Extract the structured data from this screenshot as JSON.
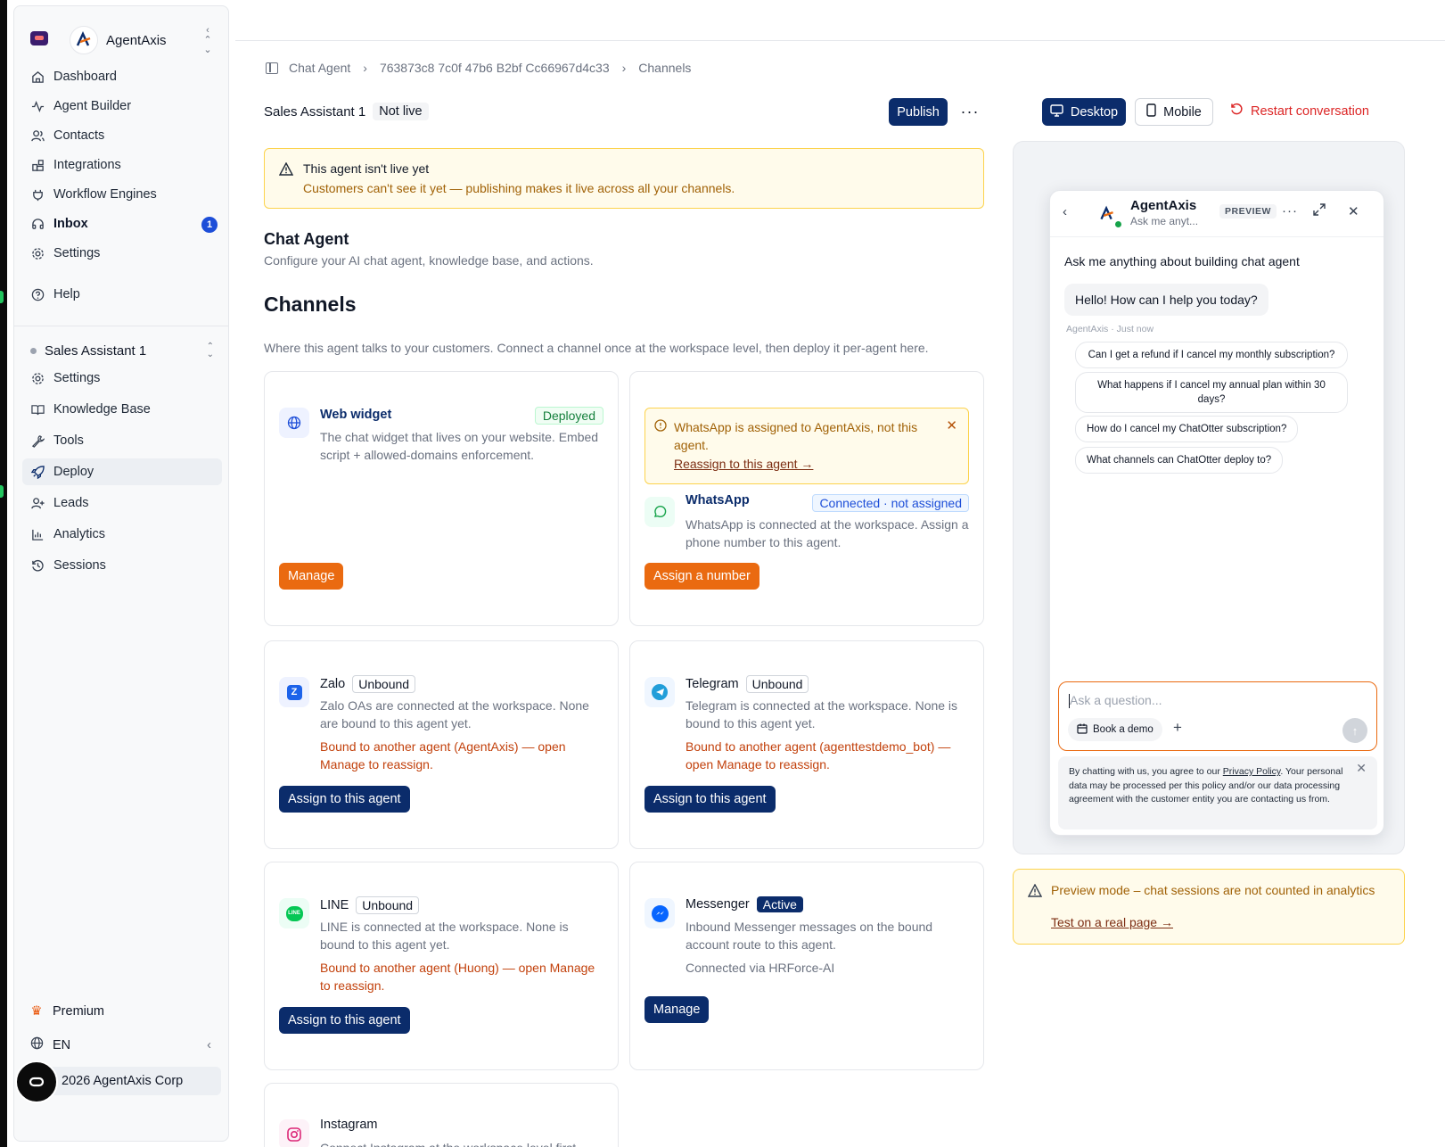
{
  "sidebar": {
    "workspace_name": "AgentAxis",
    "nav": [
      {
        "label": "Dashboard",
        "icon": "home-icon"
      },
      {
        "label": "Agent Builder",
        "icon": "activity-icon"
      },
      {
        "label": "Contacts",
        "icon": "users-icon"
      },
      {
        "label": "Integrations",
        "icon": "blocks-icon"
      },
      {
        "label": "Workflow Engines",
        "icon": "plug-icon"
      },
      {
        "label": "Inbox",
        "icon": "headset-icon",
        "badge": "1"
      },
      {
        "label": "Settings",
        "icon": "gear-icon"
      },
      {
        "label": "Help",
        "icon": "help-circle-icon"
      }
    ],
    "agent_selector": "Sales Assistant 1",
    "agent_nav": [
      {
        "label": "Settings",
        "icon": "gear-icon"
      },
      {
        "label": "Knowledge Base",
        "icon": "book-icon"
      },
      {
        "label": "Tools",
        "icon": "wrench-icon"
      },
      {
        "label": "Deploy",
        "icon": "rocket-icon",
        "active": true
      },
      {
        "label": "Leads",
        "icon": "user-plus-icon"
      },
      {
        "label": "Analytics",
        "icon": "bar-chart-icon"
      },
      {
        "label": "Sessions",
        "icon": "history-icon"
      }
    ],
    "premium": "Premium",
    "language": "EN",
    "org": "2026 AgentAxis Corp"
  },
  "breadcrumb": [
    "Chat Agent",
    "763873c8 7c0f 47b6 B2bf Cc66967d4c33",
    "Channels"
  ],
  "header": {
    "agent_name": "Sales Assistant 1",
    "status": "Not live",
    "publish": "Publish"
  },
  "alert": {
    "title": "This agent isn't live yet",
    "body": "Customers can't see it yet — publishing makes it live across all your channels."
  },
  "section": {
    "title": "Chat Agent",
    "subtitle": "Configure your AI chat agent, knowledge base, and actions.",
    "channels_title": "Channels",
    "channels_subtitle": "Where this agent talks to your customers. Connect a channel once at the workspace level, then deploy it per-agent here."
  },
  "channels": {
    "web": {
      "name": "Web widget",
      "status": "Deployed",
      "desc": "The chat widget that lives on your website. Embed script + allowed-domains enforcement.",
      "button": "Manage"
    },
    "whatsapp": {
      "alert": "WhatsApp is assigned to AgentAxis, not this agent.",
      "alert_link": "Reassign to this agent →",
      "name": "WhatsApp",
      "status": "Connected · not assigned",
      "desc": "WhatsApp is connected at the workspace. Assign a phone number to this agent.",
      "button": "Assign a number"
    },
    "zalo": {
      "name": "Zalo",
      "status": "Unbound",
      "desc": "Zalo OAs are connected at the workspace. None are bound to this agent yet.",
      "warn": "Bound to another agent (AgentAxis) — open Manage to reassign.",
      "button": "Assign to this agent"
    },
    "telegram": {
      "name": "Telegram",
      "status": "Unbound",
      "desc": "Telegram is connected at the workspace. None is bound to this agent yet.",
      "warn": "Bound to another agent (agenttestdemo_bot) — open Manage to reassign.",
      "button": "Assign to this agent"
    },
    "line": {
      "name": "LINE",
      "status": "Unbound",
      "desc": "LINE is connected at the workspace. None is bound to this agent yet.",
      "warn": "Bound to another agent (Huong) — open Manage to reassign.",
      "button": "Assign to this agent"
    },
    "messenger": {
      "name": "Messenger",
      "status": "Active",
      "desc": "Inbound Messenger messages on the bound account route to this agent.",
      "via": "Connected via HRForce-AI",
      "button": "Manage"
    },
    "instagram": {
      "name": "Instagram",
      "desc": "Connect Instagram at the workspace level first."
    }
  },
  "preview": {
    "desktop": "Desktop",
    "mobile": "Mobile",
    "restart": "Restart conversation",
    "widget": {
      "title": "AgentAxis",
      "subtitle": "Ask me anyt...",
      "badge": "PREVIEW",
      "greeting": "Ask me anything about building chat agent",
      "bubble": "Hello! How can I help you today?",
      "meta": "AgentAxis · Just now",
      "suggestions": [
        "Can I get a refund if I cancel my monthly subscription?",
        "What happens if I cancel my annual plan within 30 days?",
        "How do I cancel my ChatOtter subscription?",
        "What channels can ChatOtter deploy to?"
      ],
      "input_placeholder": "Ask a question...",
      "book_demo": "Book a demo",
      "consent_pre": "By chatting with us, you agree to our ",
      "consent_link": "Privacy Policy",
      "consent_post": ". Your personal data may be processed per this policy and/or our data processing agreement with the customer entity you are contacting us from."
    },
    "note": "Preview mode – chat sessions are not counted in analytics",
    "note_link": "Test on a real page →"
  },
  "colors": {
    "navy": "#0b2c6b",
    "orange": "#ea6a10",
    "danger": "#dc2626",
    "warn_text": "#c2410c"
  }
}
